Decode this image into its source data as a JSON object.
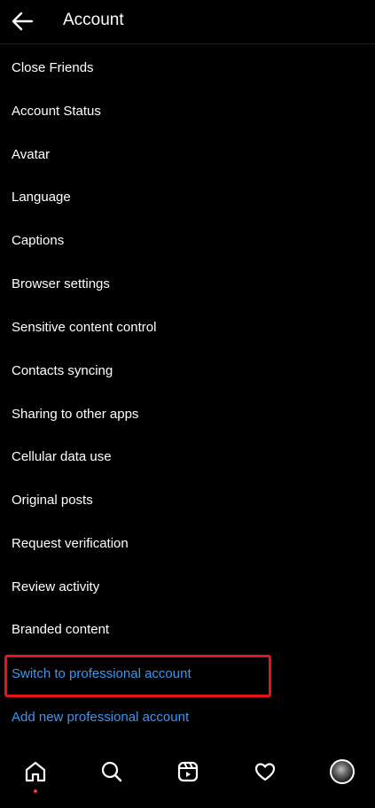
{
  "header": {
    "title": "Account",
    "back_icon": "back-arrow-icon"
  },
  "menu": {
    "items": [
      "Close Friends",
      "Account Status",
      "Avatar",
      "Language",
      "Captions",
      "Browser settings",
      "Sensitive content control",
      "Contacts syncing",
      "Sharing to other apps",
      "Cellular data use",
      "Original posts",
      "Request verification",
      "Review activity",
      "Branded content",
      "Switch to professional account",
      "Add new professional account"
    ],
    "highlighted_item": "Switch to professional account",
    "highlight_color": "#e6141a",
    "link_color": "#3b97f0"
  },
  "bottom_nav": {
    "items": [
      "home-icon",
      "search-icon",
      "reels-icon",
      "heart-icon",
      "profile-avatar"
    ]
  }
}
